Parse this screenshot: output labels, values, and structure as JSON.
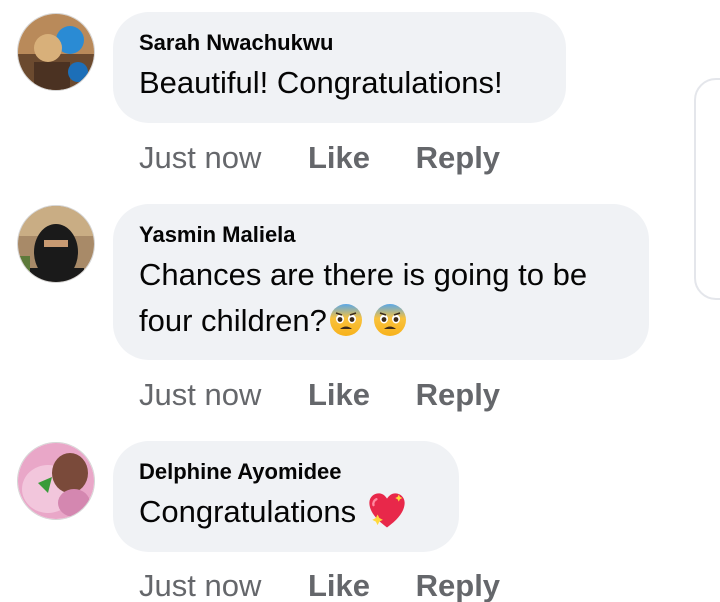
{
  "comments": [
    {
      "author": "Sarah Nwachukwu",
      "text_lines": [
        "Beautiful! Congratulations!"
      ],
      "timestamp": "Just now",
      "like_label": "Like",
      "reply_label": "Reply",
      "emojis": []
    },
    {
      "author": "Yasmin Maliela",
      "text_lines": [
        "Chances are there is going to be",
        "four children?"
      ],
      "timestamp": "Just now",
      "like_label": "Like",
      "reply_label": "Reply",
      "emojis": [
        "anxious-face-with-sweat-icon",
        "anxious-face-with-sweat-icon"
      ]
    },
    {
      "author": "Delphine Ayomidee",
      "text_lines": [
        "Congratulations "
      ],
      "timestamp": "Just now",
      "like_label": "Like",
      "reply_label": "Reply",
      "emojis": [
        "sparkling-heart-icon"
      ]
    }
  ],
  "colors": {
    "bubble": "#f0f2f5",
    "author_text": "#050505",
    "meta_text": "#65676b"
  }
}
